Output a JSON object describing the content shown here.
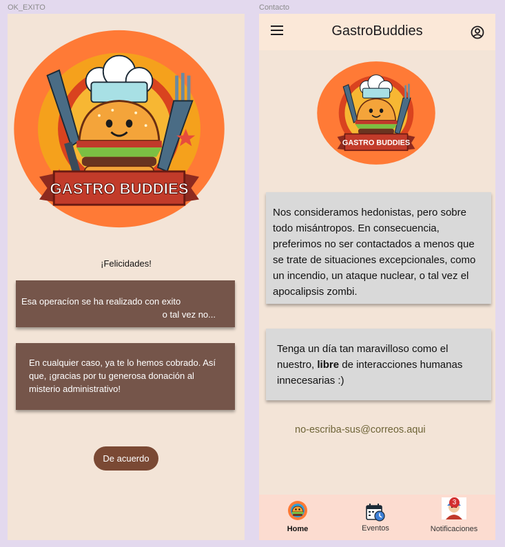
{
  "frames": {
    "ok_label": "OK_EXITO",
    "contact_label": "Contacto"
  },
  "ok_screen": {
    "logo_text": "GASTRO BUDDIES",
    "congrats": "¡Felicidades!",
    "card1_line1": "Esa operacíon se ha realizado con exito",
    "card1_line2": "o tal vez no...",
    "card2_text": "En cualquier  caso, ya te lo hemos cobrado. Así que, ¡gracias por tu generosa donación  al misterio administrativo!",
    "button_label": "De acuerdo"
  },
  "contact_screen": {
    "app_title": "GastroBuddies",
    "logo_text": "GASTRO BUDDIES",
    "card1_text": "Nos consideramos hedonistas, pero sobre todo misántropos. En consecuencia, preferimos no ser contactados a menos que se trate de situaciones excepcionales, como un incendio, un ataque nuclear, o tal vez el apocalipsis zombi.",
    "card2_before": "Tenga un día tan maravilloso como el nuestro, ",
    "card2_bold": "libre",
    "card2_after": " de interacciones humanas innecesarias :)",
    "email": "no-escriba-sus@correos.aqui",
    "nav": {
      "home": "Home",
      "events": "Eventos",
      "notifications": "Notificaciones",
      "notifications_badge": "3"
    }
  },
  "icons": {
    "menu": "menu-icon",
    "account": "account-circle-icon",
    "home": "home-logo-icon",
    "events": "calendar-clock-icon",
    "notifications": "notifications-avatar-icon"
  },
  "colors": {
    "background": "#e3d9ee",
    "screen": "#f3e4d7",
    "brown_card": "#75554a",
    "button": "#7a4934",
    "grey_card": "#d9d9d9",
    "appbar": "#fbe8d8",
    "bottom_nav": "#fcdcd0",
    "email_text": "#6e6437",
    "logo_ring": "#ff7a36",
    "badge": "#d32f2f"
  }
}
